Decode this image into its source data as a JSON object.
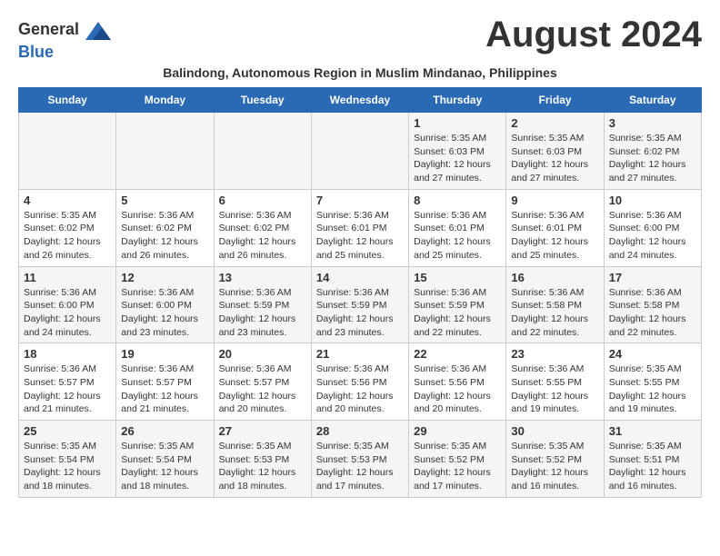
{
  "header": {
    "logo_general": "General",
    "logo_blue": "Blue",
    "month_year": "August 2024",
    "subtitle": "Balindong, Autonomous Region in Muslim Mindanao, Philippines"
  },
  "days_of_week": [
    "Sunday",
    "Monday",
    "Tuesday",
    "Wednesday",
    "Thursday",
    "Friday",
    "Saturday"
  ],
  "weeks": [
    {
      "days": [
        {
          "date": "",
          "info": ""
        },
        {
          "date": "",
          "info": ""
        },
        {
          "date": "",
          "info": ""
        },
        {
          "date": "",
          "info": ""
        },
        {
          "date": "1",
          "sunrise": "Sunrise: 5:35 AM",
          "sunset": "Sunset: 6:03 PM",
          "daylight": "Daylight: 12 hours and 27 minutes."
        },
        {
          "date": "2",
          "sunrise": "Sunrise: 5:35 AM",
          "sunset": "Sunset: 6:03 PM",
          "daylight": "Daylight: 12 hours and 27 minutes."
        },
        {
          "date": "3",
          "sunrise": "Sunrise: 5:35 AM",
          "sunset": "Sunset: 6:02 PM",
          "daylight": "Daylight: 12 hours and 27 minutes."
        }
      ]
    },
    {
      "days": [
        {
          "date": "4",
          "sunrise": "Sunrise: 5:35 AM",
          "sunset": "Sunset: 6:02 PM",
          "daylight": "Daylight: 12 hours and 26 minutes."
        },
        {
          "date": "5",
          "sunrise": "Sunrise: 5:36 AM",
          "sunset": "Sunset: 6:02 PM",
          "daylight": "Daylight: 12 hours and 26 minutes."
        },
        {
          "date": "6",
          "sunrise": "Sunrise: 5:36 AM",
          "sunset": "Sunset: 6:02 PM",
          "daylight": "Daylight: 12 hours and 26 minutes."
        },
        {
          "date": "7",
          "sunrise": "Sunrise: 5:36 AM",
          "sunset": "Sunset: 6:01 PM",
          "daylight": "Daylight: 12 hours and 25 minutes."
        },
        {
          "date": "8",
          "sunrise": "Sunrise: 5:36 AM",
          "sunset": "Sunset: 6:01 PM",
          "daylight": "Daylight: 12 hours and 25 minutes."
        },
        {
          "date": "9",
          "sunrise": "Sunrise: 5:36 AM",
          "sunset": "Sunset: 6:01 PM",
          "daylight": "Daylight: 12 hours and 25 minutes."
        },
        {
          "date": "10",
          "sunrise": "Sunrise: 5:36 AM",
          "sunset": "Sunset: 6:00 PM",
          "daylight": "Daylight: 12 hours and 24 minutes."
        }
      ]
    },
    {
      "days": [
        {
          "date": "11",
          "sunrise": "Sunrise: 5:36 AM",
          "sunset": "Sunset: 6:00 PM",
          "daylight": "Daylight: 12 hours and 24 minutes."
        },
        {
          "date": "12",
          "sunrise": "Sunrise: 5:36 AM",
          "sunset": "Sunset: 6:00 PM",
          "daylight": "Daylight: 12 hours and 23 minutes."
        },
        {
          "date": "13",
          "sunrise": "Sunrise: 5:36 AM",
          "sunset": "Sunset: 5:59 PM",
          "daylight": "Daylight: 12 hours and 23 minutes."
        },
        {
          "date": "14",
          "sunrise": "Sunrise: 5:36 AM",
          "sunset": "Sunset: 5:59 PM",
          "daylight": "Daylight: 12 hours and 23 minutes."
        },
        {
          "date": "15",
          "sunrise": "Sunrise: 5:36 AM",
          "sunset": "Sunset: 5:59 PM",
          "daylight": "Daylight: 12 hours and 22 minutes."
        },
        {
          "date": "16",
          "sunrise": "Sunrise: 5:36 AM",
          "sunset": "Sunset: 5:58 PM",
          "daylight": "Daylight: 12 hours and 22 minutes."
        },
        {
          "date": "17",
          "sunrise": "Sunrise: 5:36 AM",
          "sunset": "Sunset: 5:58 PM",
          "daylight": "Daylight: 12 hours and 22 minutes."
        }
      ]
    },
    {
      "days": [
        {
          "date": "18",
          "sunrise": "Sunrise: 5:36 AM",
          "sunset": "Sunset: 5:57 PM",
          "daylight": "Daylight: 12 hours and 21 minutes."
        },
        {
          "date": "19",
          "sunrise": "Sunrise: 5:36 AM",
          "sunset": "Sunset: 5:57 PM",
          "daylight": "Daylight: 12 hours and 21 minutes."
        },
        {
          "date": "20",
          "sunrise": "Sunrise: 5:36 AM",
          "sunset": "Sunset: 5:57 PM",
          "daylight": "Daylight: 12 hours and 20 minutes."
        },
        {
          "date": "21",
          "sunrise": "Sunrise: 5:36 AM",
          "sunset": "Sunset: 5:56 PM",
          "daylight": "Daylight: 12 hours and 20 minutes."
        },
        {
          "date": "22",
          "sunrise": "Sunrise: 5:36 AM",
          "sunset": "Sunset: 5:56 PM",
          "daylight": "Daylight: 12 hours and 20 minutes."
        },
        {
          "date": "23",
          "sunrise": "Sunrise: 5:36 AM",
          "sunset": "Sunset: 5:55 PM",
          "daylight": "Daylight: 12 hours and 19 minutes."
        },
        {
          "date": "24",
          "sunrise": "Sunrise: 5:35 AM",
          "sunset": "Sunset: 5:55 PM",
          "daylight": "Daylight: 12 hours and 19 minutes."
        }
      ]
    },
    {
      "days": [
        {
          "date": "25",
          "sunrise": "Sunrise: 5:35 AM",
          "sunset": "Sunset: 5:54 PM",
          "daylight": "Daylight: 12 hours and 18 minutes."
        },
        {
          "date": "26",
          "sunrise": "Sunrise: 5:35 AM",
          "sunset": "Sunset: 5:54 PM",
          "daylight": "Daylight: 12 hours and 18 minutes."
        },
        {
          "date": "27",
          "sunrise": "Sunrise: 5:35 AM",
          "sunset": "Sunset: 5:53 PM",
          "daylight": "Daylight: 12 hours and 18 minutes."
        },
        {
          "date": "28",
          "sunrise": "Sunrise: 5:35 AM",
          "sunset": "Sunset: 5:53 PM",
          "daylight": "Daylight: 12 hours and 17 minutes."
        },
        {
          "date": "29",
          "sunrise": "Sunrise: 5:35 AM",
          "sunset": "Sunset: 5:52 PM",
          "daylight": "Daylight: 12 hours and 17 minutes."
        },
        {
          "date": "30",
          "sunrise": "Sunrise: 5:35 AM",
          "sunset": "Sunset: 5:52 PM",
          "daylight": "Daylight: 12 hours and 16 minutes."
        },
        {
          "date": "31",
          "sunrise": "Sunrise: 5:35 AM",
          "sunset": "Sunset: 5:51 PM",
          "daylight": "Daylight: 12 hours and 16 minutes."
        }
      ]
    }
  ]
}
